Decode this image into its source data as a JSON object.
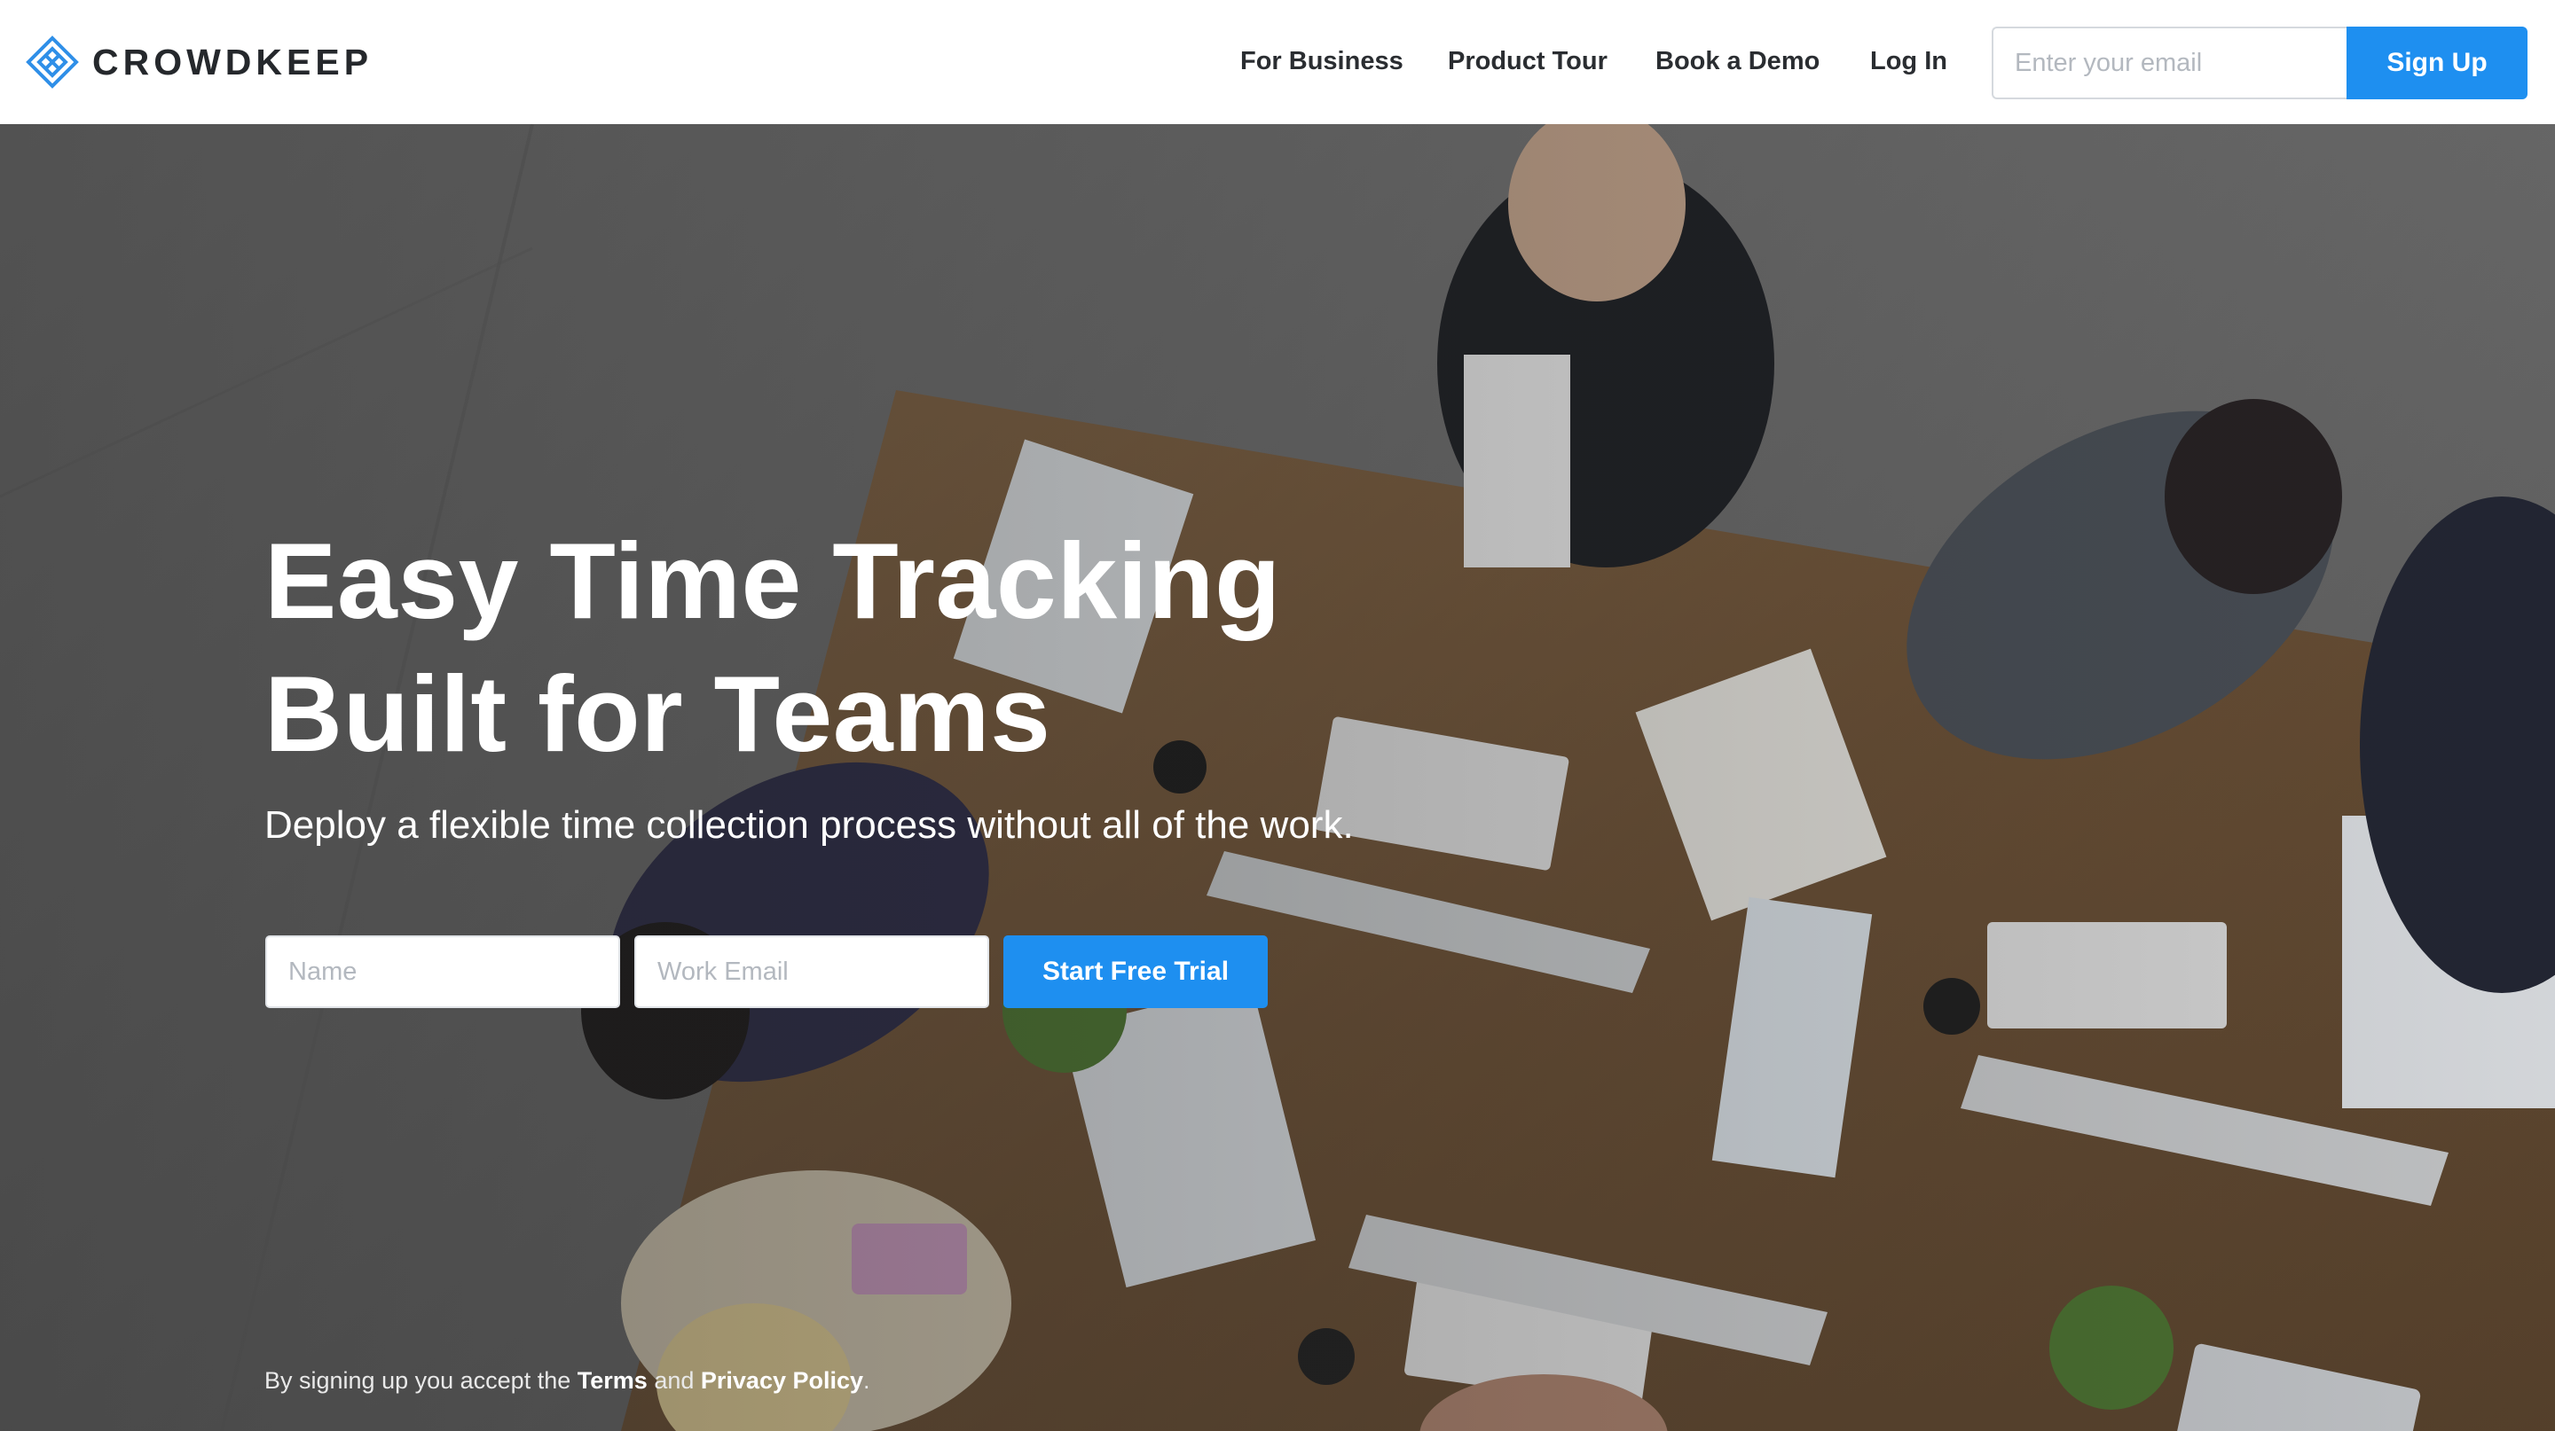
{
  "brand": {
    "name": "CROWDKEEP",
    "logo_icon": "crowdkeep-diamond-logo",
    "accent_color": "#1e8ff0"
  },
  "nav": {
    "items": [
      {
        "label": "For Business"
      },
      {
        "label": "Product Tour"
      },
      {
        "label": "Book a Demo"
      },
      {
        "label": "Log In"
      }
    ],
    "email_placeholder": "Enter your email",
    "signup_label": "Sign Up"
  },
  "hero": {
    "title_line1": "Easy Time Tracking",
    "title_line2": "Built for Teams",
    "subtitle": "Deploy a flexible time collection process without all of the work.",
    "name_placeholder": "Name",
    "email_placeholder": "Work Email",
    "cta_label": "Start Free Trial",
    "background_image": "overhead photo of a team working around a wooden desk with laptops, keyboards and papers"
  },
  "legal": {
    "prefix": "By signing up you accept the",
    "terms_label": "Terms",
    "and_text": "and",
    "privacy_label": "Privacy Policy",
    "suffix": "."
  }
}
